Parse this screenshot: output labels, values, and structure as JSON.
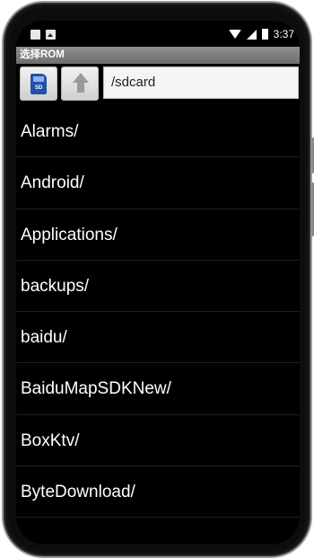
{
  "status_bar": {
    "left_icons": [
      "image-icon",
      "font-a-icon"
    ],
    "right_icons": [
      "wifi-icon",
      "cell-signal-icon",
      "battery-icon"
    ],
    "time": "3:37"
  },
  "title_bar": {
    "title": "选择ROM"
  },
  "toolbar": {
    "sd_button_icon": "sd-card-icon",
    "up_button_icon": "arrow-up-icon",
    "path": "/sdcard"
  },
  "files": [
    {
      "name": "Alarms/"
    },
    {
      "name": "Android/"
    },
    {
      "name": "Applications/"
    },
    {
      "name": "backups/"
    },
    {
      "name": "baidu/"
    },
    {
      "name": "BaiduMapSDKNew/"
    },
    {
      "name": "BoxKtv/"
    },
    {
      "name": "ByteDownload/"
    }
  ],
  "colors": {
    "background": "#000000",
    "titlebar": "#7f7f7f",
    "text": "#ffffff"
  }
}
